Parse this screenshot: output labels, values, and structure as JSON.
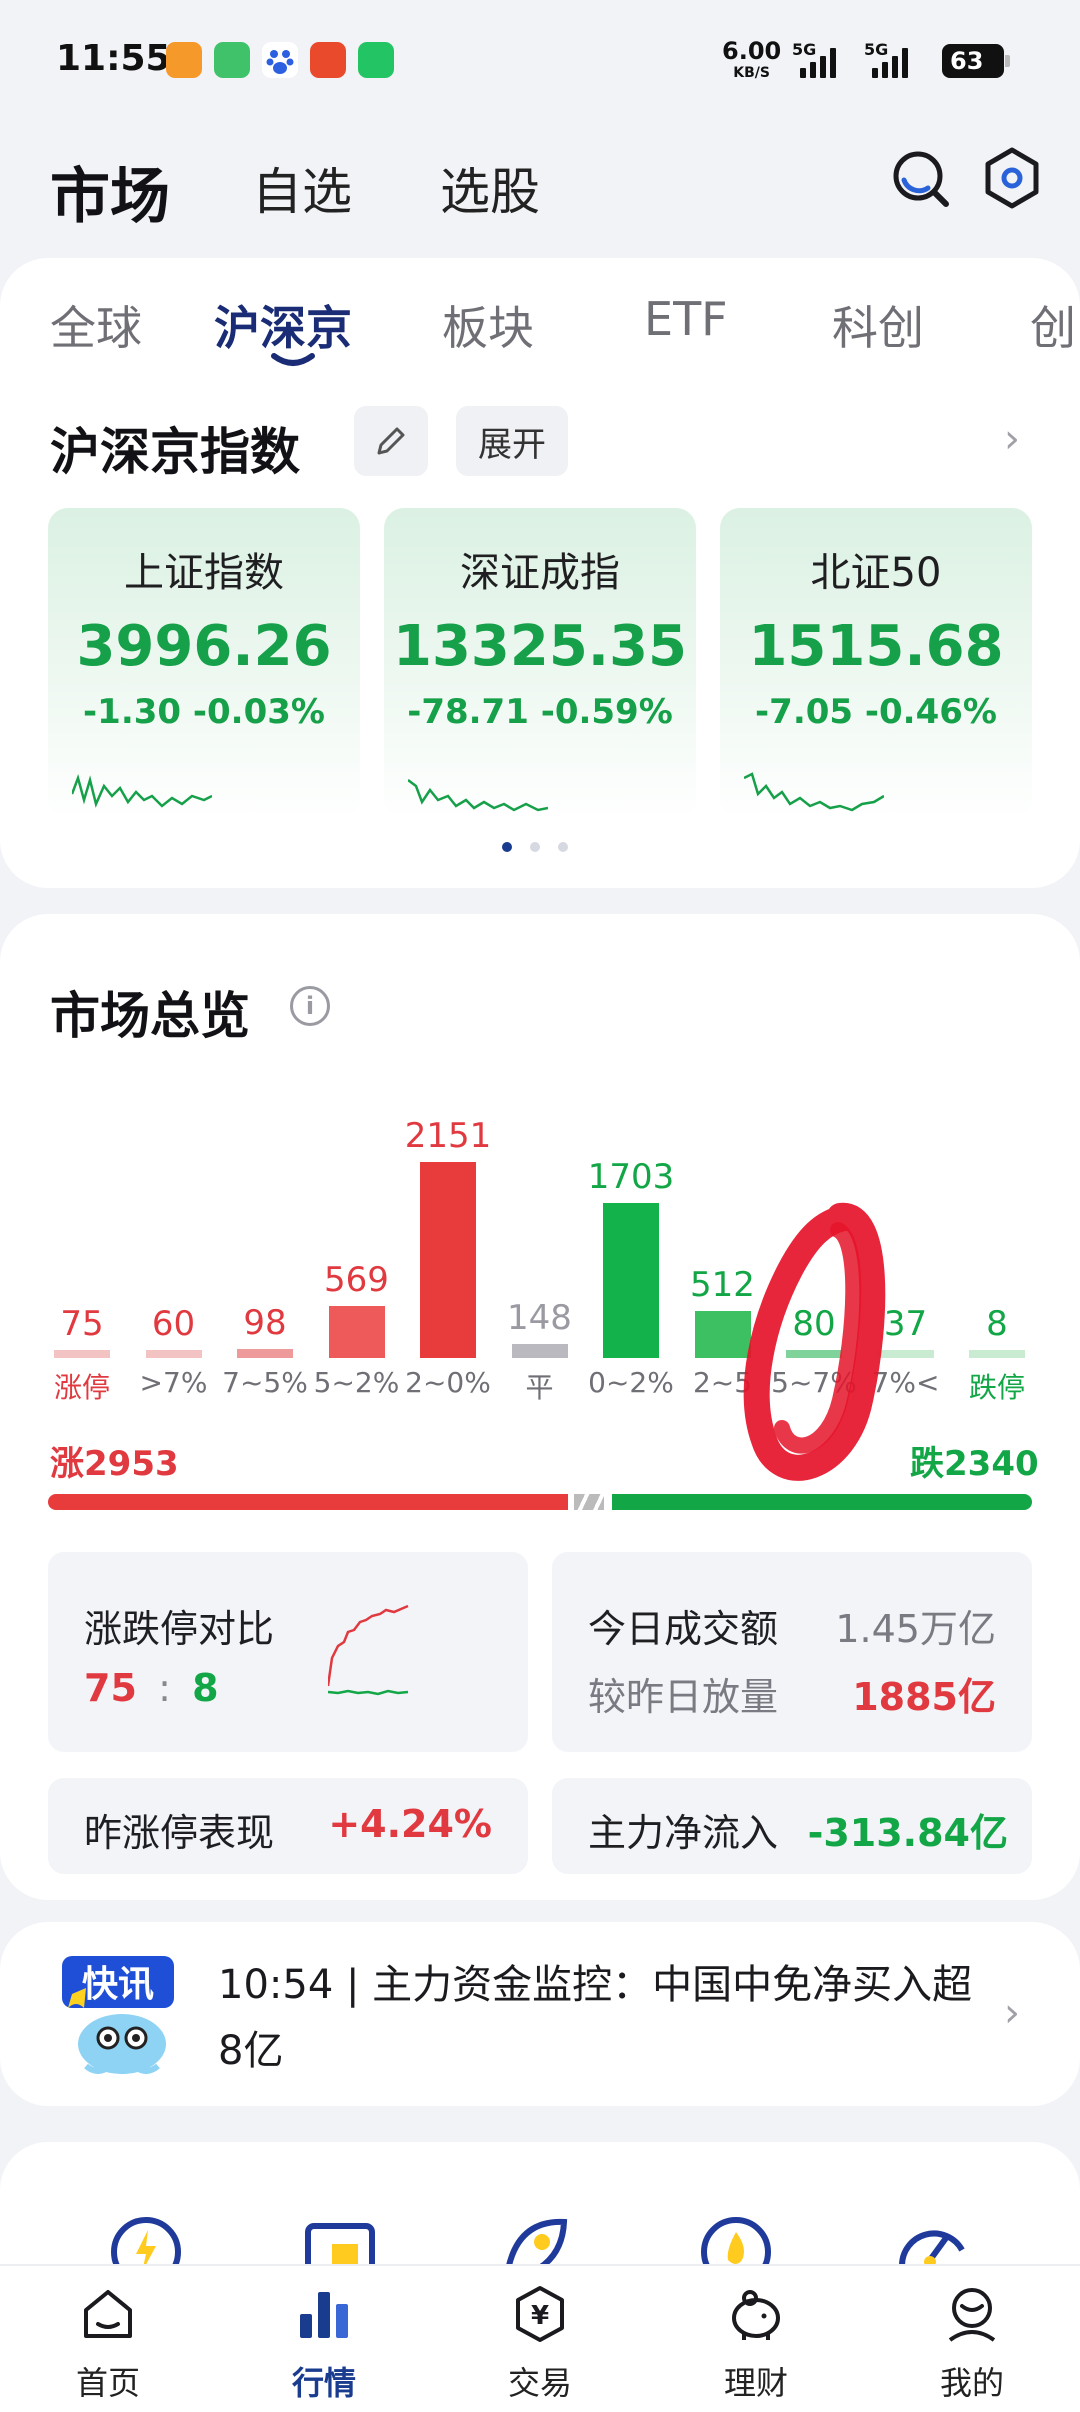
{
  "status_bar": {
    "time": "11:55",
    "net_speed": "6.00",
    "net_unit": "KB/S",
    "sig1": "5G",
    "sig2": "5G",
    "battery": "63"
  },
  "header": {
    "title": "市场",
    "tabs": [
      "自选",
      "选股"
    ],
    "icons": [
      "search-icon",
      "settings-hex-icon"
    ]
  },
  "market_tabs": [
    "全球",
    "沪深京",
    "板块",
    "ETF",
    "科创",
    "创"
  ],
  "index_section": {
    "title": "沪深京指数",
    "expand_label": "展开",
    "cards": [
      {
        "name": "上证指数",
        "value": "3996.26",
        "change": "-1.30 -0.03%"
      },
      {
        "name": "深证成指",
        "value": "13325.35",
        "change": "-78.71 -0.59%"
      },
      {
        "name": "北证50",
        "value": "1515.68",
        "change": "-7.05 -0.46%"
      }
    ]
  },
  "overview": {
    "title": "市场总览",
    "rise_label": "涨2953",
    "fall_label": "跌2340",
    "limit_compare": {
      "label": "涨跌停对比",
      "up": "75",
      "sep": ":",
      "down": "8"
    },
    "turnover": {
      "label": "今日成交额",
      "value": "1.45万亿"
    },
    "volume_change": {
      "label": "较昨日放量",
      "value": "1885亿"
    },
    "yesterday_limit": {
      "label": "昨涨停表现",
      "value": "+4.24%"
    },
    "main_flow": {
      "label": "主力净流入",
      "value": "-313.84亿"
    }
  },
  "chart_data": {
    "type": "bar",
    "categories": [
      "涨停",
      ">7%",
      "7~5%",
      "5~2%",
      "2~0%",
      "平",
      "0~2%",
      "2~5%",
      "5~7%",
      "7%<",
      "跌停"
    ],
    "category_labels_shown": [
      "涨停",
      ">7%",
      "7~5%",
      "5~2%",
      "2~0%",
      "平",
      "0~2%",
      "2~5",
      "5~7%",
      "7%<",
      "跌停"
    ],
    "values": [
      75,
      60,
      98,
      569,
      2151,
      148,
      1703,
      512,
      80,
      37,
      8
    ],
    "colors": [
      "#f3c3c3",
      "#f3c3c3",
      "#ee9a9a",
      "#ee5a5a",
      "#e83c3c",
      "#b9b9bf",
      "#14b24a",
      "#3cc062",
      "#7fd39a",
      "#c8ebd2",
      "#c8ebd2"
    ],
    "title": "",
    "xlabel": "",
    "ylabel": ""
  },
  "news": {
    "badge": "快讯",
    "text": "10:54 | 主力资金监控：中国中免净买入超8亿"
  },
  "bottom_nav": [
    {
      "label": "首页",
      "icon": "home-icon"
    },
    {
      "label": "行情",
      "icon": "market-bars-icon"
    },
    {
      "label": "交易",
      "icon": "trade-yen-icon"
    },
    {
      "label": "理财",
      "icon": "piggy-bank-icon"
    },
    {
      "label": "我的",
      "icon": "profile-icon"
    }
  ]
}
